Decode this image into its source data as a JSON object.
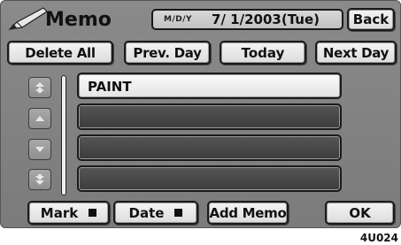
{
  "header": {
    "title": "Memo",
    "date_format": "M/D/Y",
    "date_value": "7/ 1/2003(Tue)",
    "back_label": "Back"
  },
  "nav": {
    "delete_all": "Delete All",
    "prev_day": "Prev. Day",
    "today": "Today",
    "next_day": "Next Day"
  },
  "memos": [
    "PAINT",
    "",
    "",
    ""
  ],
  "scroll_icons": [
    "double-up-arrow-icon",
    "up-arrow-icon",
    "down-arrow-icon",
    "double-down-arrow-icon"
  ],
  "footer": {
    "mark": "Mark",
    "date": "Date",
    "add_memo": "Add Memo",
    "ok": "OK"
  },
  "figure_code": "4U024"
}
